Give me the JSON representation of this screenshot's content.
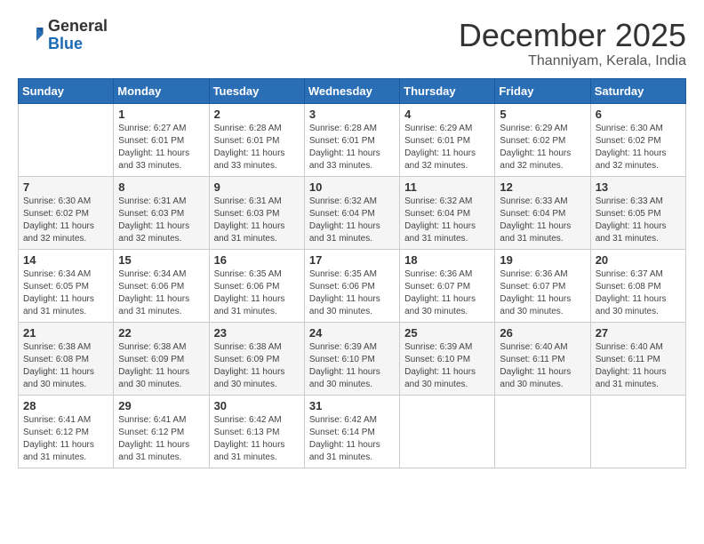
{
  "header": {
    "logo_general": "General",
    "logo_blue": "Blue",
    "month": "December 2025",
    "location": "Thanniyam, Kerala, India"
  },
  "weekdays": [
    "Sunday",
    "Monday",
    "Tuesday",
    "Wednesday",
    "Thursday",
    "Friday",
    "Saturday"
  ],
  "weeks": [
    [
      {
        "day": "",
        "sunrise": "",
        "sunset": "",
        "daylight": ""
      },
      {
        "day": "1",
        "sunrise": "Sunrise: 6:27 AM",
        "sunset": "Sunset: 6:01 PM",
        "daylight": "Daylight: 11 hours and 33 minutes."
      },
      {
        "day": "2",
        "sunrise": "Sunrise: 6:28 AM",
        "sunset": "Sunset: 6:01 PM",
        "daylight": "Daylight: 11 hours and 33 minutes."
      },
      {
        "day": "3",
        "sunrise": "Sunrise: 6:28 AM",
        "sunset": "Sunset: 6:01 PM",
        "daylight": "Daylight: 11 hours and 33 minutes."
      },
      {
        "day": "4",
        "sunrise": "Sunrise: 6:29 AM",
        "sunset": "Sunset: 6:01 PM",
        "daylight": "Daylight: 11 hours and 32 minutes."
      },
      {
        "day": "5",
        "sunrise": "Sunrise: 6:29 AM",
        "sunset": "Sunset: 6:02 PM",
        "daylight": "Daylight: 11 hours and 32 minutes."
      },
      {
        "day": "6",
        "sunrise": "Sunrise: 6:30 AM",
        "sunset": "Sunset: 6:02 PM",
        "daylight": "Daylight: 11 hours and 32 minutes."
      }
    ],
    [
      {
        "day": "7",
        "sunrise": "Sunrise: 6:30 AM",
        "sunset": "Sunset: 6:02 PM",
        "daylight": "Daylight: 11 hours and 32 minutes."
      },
      {
        "day": "8",
        "sunrise": "Sunrise: 6:31 AM",
        "sunset": "Sunset: 6:03 PM",
        "daylight": "Daylight: 11 hours and 32 minutes."
      },
      {
        "day": "9",
        "sunrise": "Sunrise: 6:31 AM",
        "sunset": "Sunset: 6:03 PM",
        "daylight": "Daylight: 11 hours and 31 minutes."
      },
      {
        "day": "10",
        "sunrise": "Sunrise: 6:32 AM",
        "sunset": "Sunset: 6:04 PM",
        "daylight": "Daylight: 11 hours and 31 minutes."
      },
      {
        "day": "11",
        "sunrise": "Sunrise: 6:32 AM",
        "sunset": "Sunset: 6:04 PM",
        "daylight": "Daylight: 11 hours and 31 minutes."
      },
      {
        "day": "12",
        "sunrise": "Sunrise: 6:33 AM",
        "sunset": "Sunset: 6:04 PM",
        "daylight": "Daylight: 11 hours and 31 minutes."
      },
      {
        "day": "13",
        "sunrise": "Sunrise: 6:33 AM",
        "sunset": "Sunset: 6:05 PM",
        "daylight": "Daylight: 11 hours and 31 minutes."
      }
    ],
    [
      {
        "day": "14",
        "sunrise": "Sunrise: 6:34 AM",
        "sunset": "Sunset: 6:05 PM",
        "daylight": "Daylight: 11 hours and 31 minutes."
      },
      {
        "day": "15",
        "sunrise": "Sunrise: 6:34 AM",
        "sunset": "Sunset: 6:06 PM",
        "daylight": "Daylight: 11 hours and 31 minutes."
      },
      {
        "day": "16",
        "sunrise": "Sunrise: 6:35 AM",
        "sunset": "Sunset: 6:06 PM",
        "daylight": "Daylight: 11 hours and 31 minutes."
      },
      {
        "day": "17",
        "sunrise": "Sunrise: 6:35 AM",
        "sunset": "Sunset: 6:06 PM",
        "daylight": "Daylight: 11 hours and 30 minutes."
      },
      {
        "day": "18",
        "sunrise": "Sunrise: 6:36 AM",
        "sunset": "Sunset: 6:07 PM",
        "daylight": "Daylight: 11 hours and 30 minutes."
      },
      {
        "day": "19",
        "sunrise": "Sunrise: 6:36 AM",
        "sunset": "Sunset: 6:07 PM",
        "daylight": "Daylight: 11 hours and 30 minutes."
      },
      {
        "day": "20",
        "sunrise": "Sunrise: 6:37 AM",
        "sunset": "Sunset: 6:08 PM",
        "daylight": "Daylight: 11 hours and 30 minutes."
      }
    ],
    [
      {
        "day": "21",
        "sunrise": "Sunrise: 6:38 AM",
        "sunset": "Sunset: 6:08 PM",
        "daylight": "Daylight: 11 hours and 30 minutes."
      },
      {
        "day": "22",
        "sunrise": "Sunrise: 6:38 AM",
        "sunset": "Sunset: 6:09 PM",
        "daylight": "Daylight: 11 hours and 30 minutes."
      },
      {
        "day": "23",
        "sunrise": "Sunrise: 6:38 AM",
        "sunset": "Sunset: 6:09 PM",
        "daylight": "Daylight: 11 hours and 30 minutes."
      },
      {
        "day": "24",
        "sunrise": "Sunrise: 6:39 AM",
        "sunset": "Sunset: 6:10 PM",
        "daylight": "Daylight: 11 hours and 30 minutes."
      },
      {
        "day": "25",
        "sunrise": "Sunrise: 6:39 AM",
        "sunset": "Sunset: 6:10 PM",
        "daylight": "Daylight: 11 hours and 30 minutes."
      },
      {
        "day": "26",
        "sunrise": "Sunrise: 6:40 AM",
        "sunset": "Sunset: 6:11 PM",
        "daylight": "Daylight: 11 hours and 30 minutes."
      },
      {
        "day": "27",
        "sunrise": "Sunrise: 6:40 AM",
        "sunset": "Sunset: 6:11 PM",
        "daylight": "Daylight: 11 hours and 31 minutes."
      }
    ],
    [
      {
        "day": "28",
        "sunrise": "Sunrise: 6:41 AM",
        "sunset": "Sunset: 6:12 PM",
        "daylight": "Daylight: 11 hours and 31 minutes."
      },
      {
        "day": "29",
        "sunrise": "Sunrise: 6:41 AM",
        "sunset": "Sunset: 6:12 PM",
        "daylight": "Daylight: 11 hours and 31 minutes."
      },
      {
        "day": "30",
        "sunrise": "Sunrise: 6:42 AM",
        "sunset": "Sunset: 6:13 PM",
        "daylight": "Daylight: 11 hours and 31 minutes."
      },
      {
        "day": "31",
        "sunrise": "Sunrise: 6:42 AM",
        "sunset": "Sunset: 6:14 PM",
        "daylight": "Daylight: 11 hours and 31 minutes."
      },
      {
        "day": "",
        "sunrise": "",
        "sunset": "",
        "daylight": ""
      },
      {
        "day": "",
        "sunrise": "",
        "sunset": "",
        "daylight": ""
      },
      {
        "day": "",
        "sunrise": "",
        "sunset": "",
        "daylight": ""
      }
    ]
  ]
}
